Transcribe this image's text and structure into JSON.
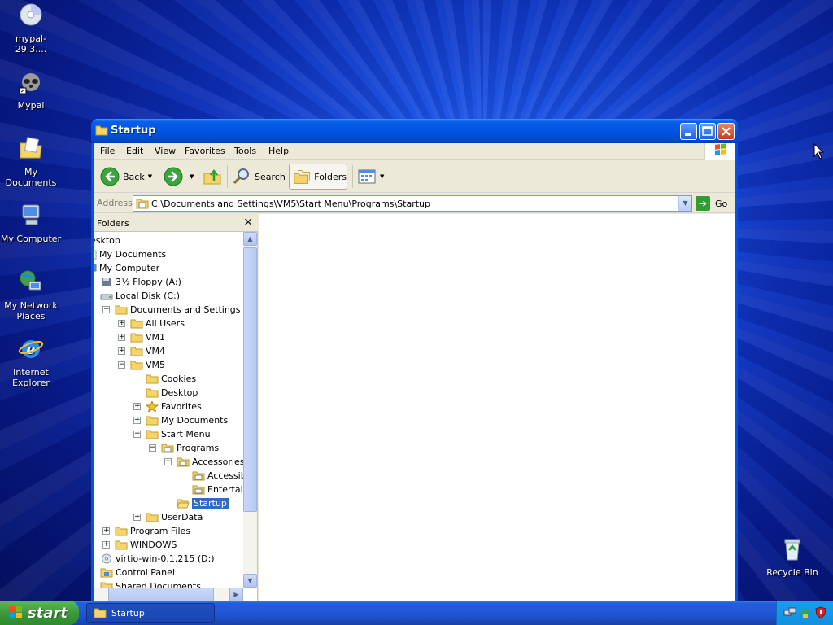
{
  "desktop": {
    "icons": [
      {
        "label": "mypal-29.3...."
      },
      {
        "label": "Mypal"
      },
      {
        "label": "My Documents"
      },
      {
        "label": "My Computer"
      },
      {
        "label": "My Network Places"
      },
      {
        "label": "Internet Explorer"
      },
      {
        "label": "Recycle Bin"
      }
    ]
  },
  "window": {
    "title": "Startup",
    "menu": [
      "File",
      "Edit",
      "View",
      "Favorites",
      "Tools",
      "Help"
    ],
    "toolbar": {
      "back": "Back",
      "search": "Search",
      "folders": "Folders"
    },
    "address": {
      "label": "Address",
      "value": "C:\\Documents and Settings\\VM5\\Start Menu\\Programs\\Startup",
      "go": "Go"
    },
    "folders_pane": {
      "title": "Folders",
      "close": "×",
      "tree": [
        {
          "label": "esktop"
        },
        {
          "label": "My Documents"
        },
        {
          "label": "My Computer"
        },
        {
          "label": "3½ Floppy (A:)"
        },
        {
          "label": "Local Disk (C:)"
        },
        {
          "label": "Documents and Settings"
        },
        {
          "label": "All Users"
        },
        {
          "label": "VM1"
        },
        {
          "label": "VM4"
        },
        {
          "label": "VM5"
        },
        {
          "label": "Cookies"
        },
        {
          "label": "Desktop"
        },
        {
          "label": "Favorites"
        },
        {
          "label": "My Documents"
        },
        {
          "label": "Start Menu"
        },
        {
          "label": "Programs"
        },
        {
          "label": "Accessories"
        },
        {
          "label": "Accessib"
        },
        {
          "label": "Entertair"
        },
        {
          "label": "Startup"
        },
        {
          "label": "UserData"
        },
        {
          "label": "Program Files"
        },
        {
          "label": "WINDOWS"
        },
        {
          "label": "virtio-win-0.1.215 (D:)"
        },
        {
          "label": "Control Panel"
        },
        {
          "label": "Shared Documents"
        }
      ],
      "selected": "Startup"
    }
  },
  "taskbar": {
    "start_label": "start",
    "tasks": [
      {
        "label": "Startup"
      }
    ]
  },
  "colors": {
    "titlebar": "#0054e3",
    "selection": "#316ac5",
    "start_button": "#3c9a3c",
    "taskbar": "#245edb"
  }
}
